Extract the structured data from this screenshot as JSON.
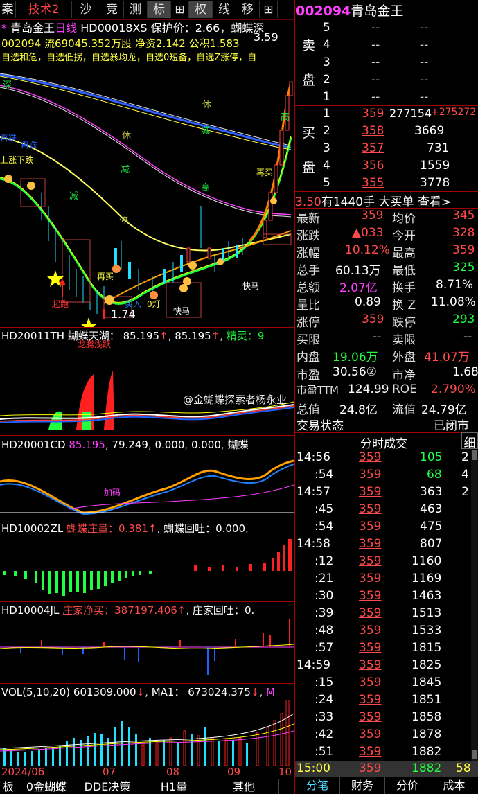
{
  "toolbar": {
    "items": [
      "案",
      "技术2",
      "沙",
      "竞",
      "测",
      "标",
      "⊞",
      "权",
      "线",
      "移",
      "⊞"
    ],
    "stock_code": "002094",
    "stock_name": "青岛金王"
  },
  "chart_header": {
    "line1_star": "*",
    "line1_name": "青岛金王",
    "line1_period": "日线",
    "line1_indicator": "HD00018XS",
    "line1_protect": "保护价：2.66，蝴蝶深",
    "line2": "002094 流69045.352万股 净资2.142 公积1.583",
    "line3": "自选和危，自选低拐，自选暴均龙，自选0短备，自选Z涨停，自",
    "price_high": "3.59",
    "price_low": "1.74"
  },
  "chart_labels": {
    "deep": "深",
    "rest": "休",
    "reduce": "减",
    "high": "高",
    "fall": "跌",
    "stop": "停",
    "again_fall": "再跌",
    "again_buy": "再买",
    "quick_buy": "快马",
    "fast": "快马",
    "add": "加码",
    "pullback": "回调",
    "huge": "暴跌",
    "up_fall": "上涨下跌",
    "label_buy": "买入",
    "label_zero": "0灯",
    "label_dragon": "龙腾浅跃",
    "label_rise": "起跑"
  },
  "panels": {
    "p1": {
      "code": "HD20011TH",
      "name": "蝴蝶天湖：",
      "v1": "85.195",
      "v2": "85.195",
      "name2": "精灵：",
      "v3": "9"
    },
    "p2": {
      "code": "HD20001CD",
      "v1": "85.195",
      "v2": "79.249",
      "v3": "0.000",
      "v4": "0.000",
      "name": "蝴蝶"
    },
    "p3": {
      "code": "HD10002ZL",
      "name": "蝴蝶庄量：",
      "v1": "0.381",
      "name2": "蝴蝶回吐：",
      "v2": "0.000"
    },
    "p4": {
      "code": "HD10004JL",
      "name": "庄家净买：",
      "v1": "387197.406",
      "name2": "庄家回吐：",
      "v2": "0."
    },
    "p5": {
      "code": "VOL(5,10,20)",
      "v1": "601309.000",
      "name2": "MA1：",
      "v2": "673024.375",
      "v3": "M"
    }
  },
  "x_axis": [
    "2024/06",
    "07",
    "08",
    "09",
    "10"
  ],
  "watermark": "@金蝴蝶探索者杨永业",
  "order_book": {
    "sell_label": [
      "卖",
      "盘"
    ],
    "buy_label": [
      "买",
      "盘"
    ],
    "sell": [
      {
        "lvl": "5",
        "price": "--",
        "vol": "--"
      },
      {
        "lvl": "4",
        "price": "--",
        "vol": "--"
      },
      {
        "lvl": "3",
        "price": "--",
        "vol": "--"
      },
      {
        "lvl": "2",
        "price": "--",
        "vol": "--"
      },
      {
        "lvl": "1",
        "price": "--",
        "vol": "--"
      }
    ],
    "buy": [
      {
        "lvl": "1",
        "price": "359",
        "vol": "277154",
        "chg": "+275272"
      },
      {
        "lvl": "2",
        "price": "358",
        "vol": "3669",
        "chg": ""
      },
      {
        "lvl": "3",
        "price": "357",
        "vol": "731",
        "chg": ""
      },
      {
        "lvl": "4",
        "price": "356",
        "vol": "1559",
        "chg": ""
      },
      {
        "lvl": "5",
        "price": "355",
        "vol": "3778",
        "chg": ""
      }
    ]
  },
  "big_order": {
    "price": "3.50",
    "text": "有1440手 大买单",
    "link": "查看>"
  },
  "quote": [
    {
      "l1": "最新",
      "v1": "359",
      "c1": "red",
      "l2": "均价",
      "v2": "345",
      "c2": "red"
    },
    {
      "l1": "涨跌",
      "v1": "▲033",
      "c1": "red",
      "l2": "今开",
      "v2": "328",
      "c2": "red"
    },
    {
      "l1": "涨幅",
      "v1": "10.12%",
      "c1": "red",
      "l2": "最高",
      "v2": "359",
      "c2": "red"
    },
    {
      "l1": "总手",
      "v1": "60.13万",
      "c1": "white",
      "l2": "最低",
      "v2": "325",
      "c2": "green"
    },
    {
      "l1": "总额",
      "v1": "2.07亿",
      "c1": "magenta",
      "l2": "换手",
      "v2": "8.71%",
      "c2": "white"
    },
    {
      "l1": "量比",
      "v1": "0.89",
      "c1": "white",
      "l2": "换 Z",
      "v2": "11.08%",
      "c2": "white"
    },
    {
      "l1": "涨停",
      "v1": "359",
      "c1": "red",
      "l2": "跌停",
      "v2": "293",
      "c2": "green"
    },
    {
      "l1": "买限",
      "v1": "--",
      "c1": "white",
      "l2": "卖限",
      "v2": "--",
      "c2": "white"
    },
    {
      "l1": "内盘",
      "v1": "19.06万",
      "c1": "green",
      "l2": "外盘",
      "v2": "41.07万",
      "c2": "red"
    },
    {
      "l1": "市盈",
      "v1": "30.56②",
      "c1": "white",
      "l2": "市净",
      "v2": "1.68",
      "c2": "white"
    },
    {
      "l1": "市盈TTM",
      "v1": "124.99",
      "c1": "white",
      "l2": "ROE",
      "v2": "2.790%",
      "c2": "red"
    },
    {
      "l1": "总值",
      "v1": "24.8亿",
      "c1": "white",
      "l2": "流值",
      "v2": "24.79亿",
      "c2": "white"
    }
  ],
  "trade_status": {
    "label": "交易状态",
    "value": "已闭市"
  },
  "ticks_header": {
    "title": "分时成交",
    "btn": "细"
  },
  "ticks": [
    {
      "t": "14:56",
      "p": "359",
      "v": "105",
      "n": "2",
      "vc": "green"
    },
    {
      "t": ":54",
      "p": "359",
      "v": "68",
      "n": "4",
      "vc": "green"
    },
    {
      "t": "14:57",
      "p": "359",
      "v": "363",
      "n": "2",
      "vc": "white"
    },
    {
      "t": ":45",
      "p": "359",
      "v": "463",
      "n": "",
      "vc": "white"
    },
    {
      "t": ":54",
      "p": "359",
      "v": "475",
      "n": "",
      "vc": "white"
    },
    {
      "t": "14:58",
      "p": "359",
      "v": "807",
      "n": "",
      "vc": "white"
    },
    {
      "t": ":12",
      "p": "359",
      "v": "1160",
      "n": "",
      "vc": "white"
    },
    {
      "t": ":21",
      "p": "359",
      "v": "1169",
      "n": "",
      "vc": "white"
    },
    {
      "t": ":30",
      "p": "359",
      "v": "1463",
      "n": "",
      "vc": "white"
    },
    {
      "t": ":39",
      "p": "359",
      "v": "1513",
      "n": "",
      "vc": "white"
    },
    {
      "t": ":48",
      "p": "359",
      "v": "1533",
      "n": "",
      "vc": "white"
    },
    {
      "t": ":57",
      "p": "359",
      "v": "1815",
      "n": "",
      "vc": "white"
    },
    {
      "t": "14:59",
      "p": "359",
      "v": "1825",
      "n": "",
      "vc": "white"
    },
    {
      "t": ":15",
      "p": "359",
      "v": "1845",
      "n": "",
      "vc": "white"
    },
    {
      "t": ":24",
      "p": "359",
      "v": "1851",
      "n": "",
      "vc": "white"
    },
    {
      "t": ":33",
      "p": "359",
      "v": "1858",
      "n": "",
      "vc": "white"
    },
    {
      "t": ":42",
      "p": "359",
      "v": "1878",
      "n": "",
      "vc": "white"
    },
    {
      "t": ":51",
      "p": "359",
      "v": "1882",
      "n": "",
      "vc": "white"
    }
  ],
  "last_tick": {
    "t": "15:00",
    "p": "359",
    "v": "1882",
    "n": "58"
  },
  "bottom_tabs": [
    "板",
    "0金蝴蝶",
    "DDE决策",
    "H1量",
    "其他"
  ],
  "right_tabs": [
    "分笔",
    "财务",
    "分价",
    "成本"
  ]
}
